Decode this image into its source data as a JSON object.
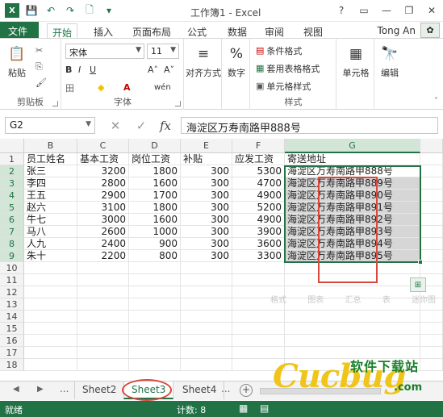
{
  "window": {
    "title": "工作簿1 - Excel",
    "help": "?",
    "minimize": "—",
    "restore": "❐",
    "close": "✕"
  },
  "qat": {
    "save_icon": "💾",
    "undo_icon": "↶",
    "redo_icon": "↷",
    "preview_icon": "🗋",
    "customize_icon": "▾"
  },
  "tabs": {
    "file": "文件",
    "home": "开始",
    "insert": "插入",
    "layout": "页面布局",
    "formulas": "公式",
    "data": "数据",
    "review": "审阅",
    "view": "视图"
  },
  "user": {
    "name": "Tong An",
    "avatar": "✿"
  },
  "ribbon": {
    "clipboard": {
      "label": "剪贴板",
      "paste": "粘贴",
      "paste_icon": "📋",
      "cut_icon": "✂",
      "copy_icon": "⎘",
      "painter_icon": "🖌"
    },
    "font": {
      "label": "字体",
      "name": "宋体",
      "size": "11",
      "grow": "A˄",
      "shrink": "A˅",
      "bold": "B",
      "italic": "I",
      "underline": "U",
      "border": "田",
      "fill": "◆",
      "fontcolor": "A",
      "phonetic": "wén"
    },
    "alignment": {
      "label": "对齐方式",
      "icon": "≡"
    },
    "number": {
      "label": "数字",
      "icon": "%"
    },
    "styles": {
      "label": "样式",
      "conditional": "条件格式",
      "table": "套用表格格式",
      "cell": "单元格样式"
    },
    "cells": {
      "label": "单元格",
      "icon": "▦"
    },
    "editing": {
      "label": "编辑",
      "icon": "🔭"
    }
  },
  "formula_bar": {
    "name_box": "G2",
    "cancel": "✕",
    "enter": "✓",
    "fx": "fx",
    "value": "海淀区万寿南路甲888号"
  },
  "columns": [
    "B",
    "C",
    "D",
    "E",
    "F",
    "G"
  ],
  "rows": [
    "1",
    "2",
    "3",
    "4",
    "5",
    "6",
    "7",
    "8",
    "9",
    "10",
    "11",
    "12",
    "13",
    "14",
    "15",
    "16",
    "17",
    "18"
  ],
  "table": {
    "headers": [
      "员工姓名",
      "基本工资",
      "岗位工资",
      "补贴",
      "应发工资",
      "寄送地址"
    ],
    "data": [
      [
        "张三",
        "3200",
        "1800",
        "300",
        "5300",
        "海淀区万寿南路甲888号"
      ],
      [
        "李四",
        "2800",
        "1600",
        "300",
        "4700",
        "海淀区万寿南路甲889号"
      ],
      [
        "王五",
        "2900",
        "1700",
        "300",
        "4900",
        "海淀区万寿南路甲890号"
      ],
      [
        "赵六",
        "3100",
        "1800",
        "300",
        "5200",
        "海淀区万寿南路甲891号"
      ],
      [
        "牛七",
        "3000",
        "1600",
        "300",
        "4900",
        "海淀区万寿南路甲892号"
      ],
      [
        "马八",
        "2600",
        "1000",
        "300",
        "3900",
        "海淀区万寿南路甲893号"
      ],
      [
        "人九",
        "2400",
        "900",
        "300",
        "3600",
        "海淀区万寿南路甲894号"
      ],
      [
        "朱十",
        "2200",
        "800",
        "300",
        "3300",
        "海淀区万寿南路甲895号"
      ]
    ]
  },
  "quick_analysis": {
    "icon": "⊞",
    "options": [
      "格式",
      "图表",
      "汇总",
      "表",
      "迷你图"
    ]
  },
  "sheets": {
    "nav_prev": "◀",
    "nav_next": "▶",
    "more": "...",
    "tabs": [
      "Sheet2",
      "Sheet3",
      "Sheet4"
    ],
    "add": "+"
  },
  "status": {
    "ready": "就绪",
    "count": "计数: 8"
  },
  "watermark": {
    "top": "软件下载站",
    "big": "Cucbug",
    "com": ".com"
  }
}
